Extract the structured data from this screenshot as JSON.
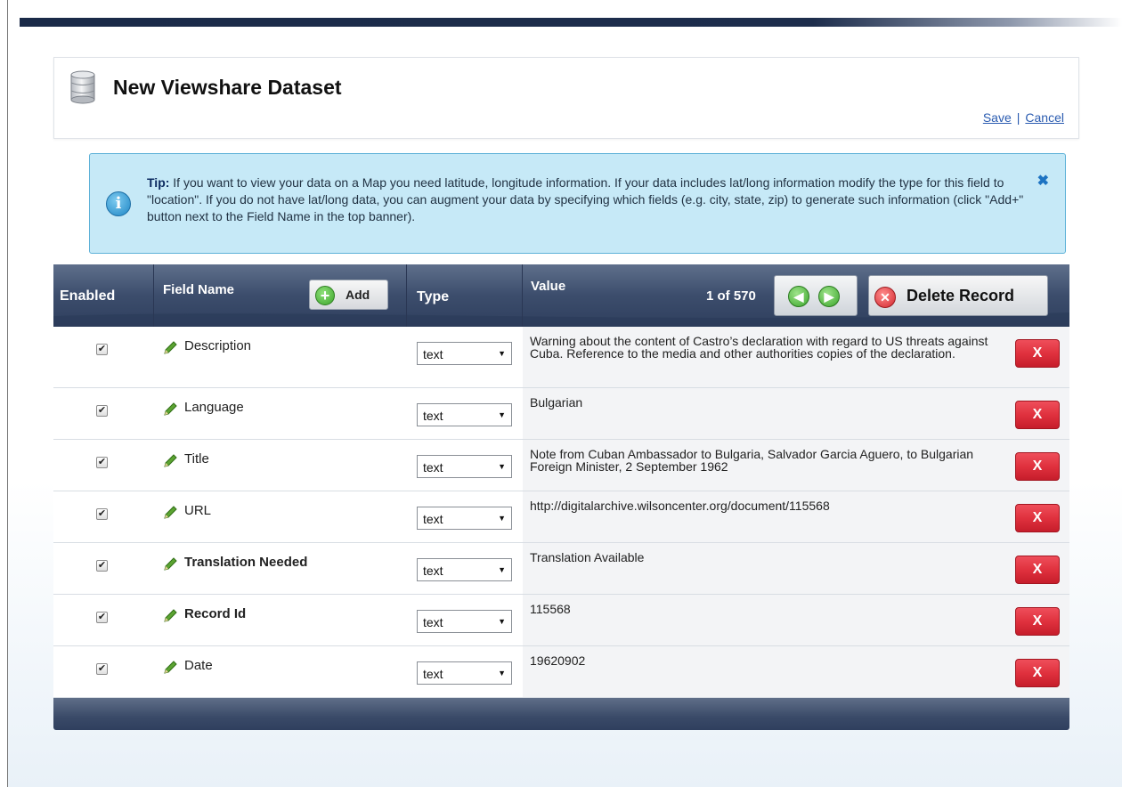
{
  "page": {
    "title": "New Viewshare Dataset",
    "save_label": "Save",
    "separator": "|",
    "cancel_label": "Cancel"
  },
  "tip": {
    "label": "Tip:",
    "text": "If you want to view your data on a Map you need latitude, longitude information. If your data includes lat/long information modify the type for this field to \"location\". If you do not have lat/long data, you can augment your data by specifying which fields (e.g. city, state, zip) to generate such information (click \"Add+\" button next to the Field Name in the top banner).",
    "close": "✖"
  },
  "grid": {
    "headers": {
      "enabled": "Enabled",
      "field_name": "Field Name",
      "add_label": "Add",
      "type": "Type",
      "value": "Value"
    },
    "counter": "1 of 570",
    "delete_record_label": "Delete Record",
    "x_label": "X",
    "rows": [
      {
        "enabled": true,
        "field": "Description",
        "bold": false,
        "type": "text",
        "value": "Warning about the content of Castro’s declaration with regard to US threats against Cuba. Reference to the media and other authorities copies of the declaration."
      },
      {
        "enabled": true,
        "field": "Language",
        "bold": false,
        "type": "text",
        "value": "Bulgarian"
      },
      {
        "enabled": true,
        "field": "Title",
        "bold": false,
        "type": "text",
        "value": "Note from Cuban Ambassador to Bulgaria, Salvador Garcia Aguero, to Bulgarian Foreign Minister, 2 September 1962"
      },
      {
        "enabled": true,
        "field": "URL",
        "bold": false,
        "type": "text",
        "value": "http://digitalarchive.wilsoncenter.org/document/115568"
      },
      {
        "enabled": true,
        "field": "Translation Needed",
        "bold": true,
        "type": "text",
        "value": "Translation Available"
      },
      {
        "enabled": true,
        "field": "Record Id",
        "bold": true,
        "type": "text",
        "value": "115568"
      },
      {
        "enabled": true,
        "field": "Date",
        "bold": false,
        "type": "text",
        "value": "19620902"
      }
    ]
  },
  "icons": {
    "dataset": "database-icon",
    "info": "info-icon",
    "edit": "pencil-icon",
    "add": "plus-circle-icon",
    "prev": "arrow-left-icon",
    "next": "arrow-right-icon",
    "delete": "x-circle-icon"
  },
  "colors": {
    "header_bar": "#3c4d6c",
    "tip_bg": "#c6e9f7",
    "delete_red": "#e0313e",
    "link_blue": "#2a5bb0"
  }
}
